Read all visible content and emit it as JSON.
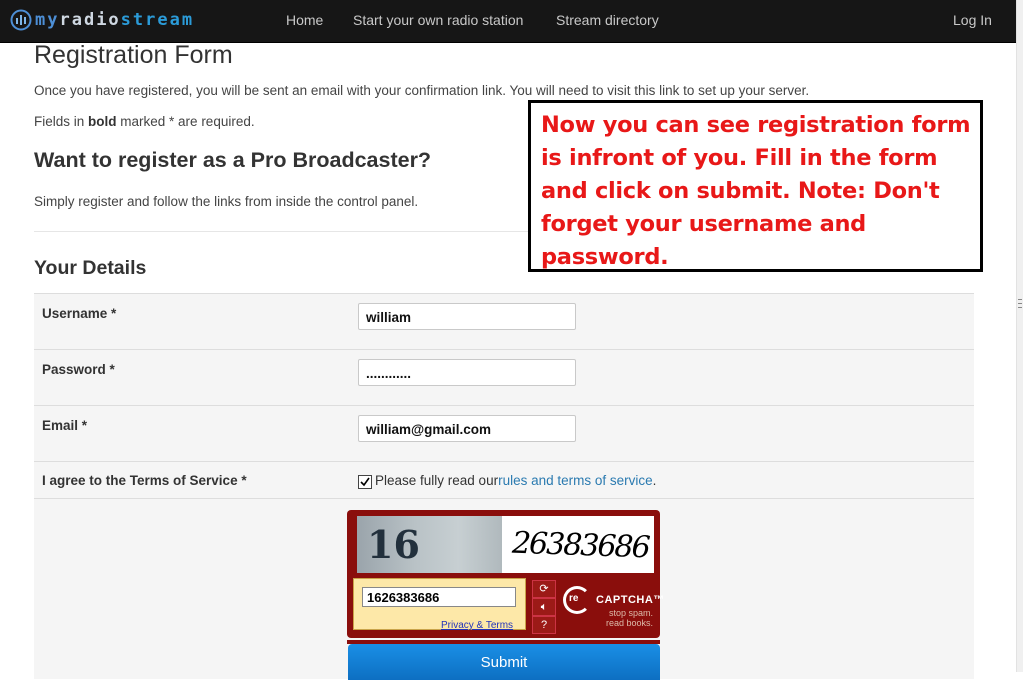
{
  "nav": {
    "brand": {
      "my": "my",
      "radio": "radio",
      "stream": "stream"
    },
    "links": [
      "Home",
      "Start your own radio station",
      "Stream directory"
    ],
    "login": "Log In"
  },
  "page": {
    "title": "Registration Form",
    "intro": "Once you have registered, you will be sent an email with your confirmation link. You will need to visit this link to set up your server.",
    "required_prefix": "Fields in ",
    "required_bold": "bold",
    "required_suffix": " marked * are required.",
    "pro_heading": "Want to register as a Pro Broadcaster?",
    "pro_text": "Simply register and follow the links from inside the control panel."
  },
  "details": {
    "title": "Your Details",
    "username_label": "Username *",
    "username_value": "william",
    "password_label": "Password *",
    "password_value": "............",
    "email_label": "Email *",
    "email_value": "william@gmail.com",
    "tos_label": "I agree to the Terms of Service *",
    "tos_text": "Please fully read our ",
    "tos_link": "rules and terms of service",
    "tos_checked": true
  },
  "captcha": {
    "photo_text": "16",
    "word_text": "26383686",
    "input_value": "1626383686",
    "privacy": "Privacy & Terms",
    "brand_re": "re",
    "brand_name": "CAPTCHA™",
    "tagline": "stop spam. read books."
  },
  "submit": "Submit",
  "annotation": "Now you can see registration form is infront of you. Fill in the form and click on submit. Note: Don't forget your username and password.",
  "colors": {
    "navbar": "#161616",
    "link": "#2a7ab0",
    "annotation_text": "#e81818",
    "recaptcha": "#8a0e0c",
    "submit": "#1a8fe6"
  }
}
